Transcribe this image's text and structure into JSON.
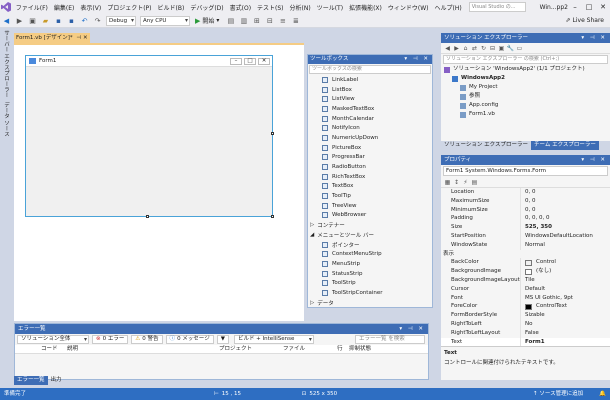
{
  "menu": {
    "items": [
      "ファイル(F)",
      "編集(E)",
      "表示(V)",
      "プロジェクト(P)",
      "ビルド(B)",
      "デバッグ(D)",
      "書式(O)",
      "テスト(S)",
      "分析(N)",
      "ツール(T)",
      "拡張機能(X)",
      "ウィンドウ(W)",
      "ヘルプ(H)"
    ],
    "search_placeholder": "Visual Studio の...",
    "window_title": "Win...pp2"
  },
  "toolbar": {
    "config": "Debug",
    "platform": "Any CPU",
    "start": "開始",
    "live_share": "Live Share"
  },
  "left_tabs": [
    "サーバー エクスプローラー",
    "データ ソース"
  ],
  "doc_tab": "Form1.vb [デザイン]*",
  "form": {
    "title": "Form1"
  },
  "toolbox": {
    "title": "ツールボックス",
    "search_placeholder": "ツールボックスの検索",
    "items": [
      "LinkLabel",
      "ListBox",
      "ListView",
      "MaskedTextBox",
      "MonthCalendar",
      "NotifyIcon",
      "NumericUpDown",
      "PictureBox",
      "ProgressBar",
      "RadioButton",
      "RichTextBox",
      "TextBox",
      "ToolTip",
      "TreeView",
      "WebBrowser"
    ],
    "cat1": "コンテナー",
    "cat2": "メニューとツール バー",
    "items2": [
      "ポインター",
      "ContextMenuStrip",
      "MenuStrip",
      "StatusStrip",
      "ToolStrip",
      "ToolStripContainer"
    ],
    "cat3": "データ"
  },
  "solution": {
    "title": "ソリューション エクスプローラー",
    "search_placeholder": "ソリューション エクスプローラー の検索 (Ctrl+;)",
    "tree": [
      {
        "label": "ソリューション 'WindowsApp2' (1/1 プロジェクト)",
        "indent": 0,
        "bold": false
      },
      {
        "label": "WindowsApp2",
        "indent": 1,
        "bold": true
      },
      {
        "label": "My Project",
        "indent": 2,
        "bold": false
      },
      {
        "label": "参照",
        "indent": 2,
        "bold": false
      },
      {
        "label": "App.config",
        "indent": 2,
        "bold": false
      },
      {
        "label": "Form1.vb",
        "indent": 2,
        "bold": false
      }
    ],
    "tab1": "ソリューション エクスプローラー",
    "tab2": "チーム エクスプローラー"
  },
  "properties": {
    "title": "プロパティ",
    "object": "Form1 System.Windows.Forms.Form",
    "rows": [
      {
        "name": "Location",
        "value": "0, 0"
      },
      {
        "name": "MaximumSize",
        "value": "0, 0"
      },
      {
        "name": "MinimumSize",
        "value": "0, 0"
      },
      {
        "name": "Padding",
        "value": "0, 0, 0, 0"
      },
      {
        "name": "Size",
        "value": "525, 350",
        "bold": true
      },
      {
        "name": "StartPosition",
        "value": "WindowsDefaultLocation"
      },
      {
        "name": "WindowState",
        "value": "Normal"
      },
      {
        "name": "表示",
        "value": "",
        "cat": true
      },
      {
        "name": "BackColor",
        "value": "Control",
        "swatch": "#f0f0f0"
      },
      {
        "name": "BackgroundImage",
        "value": "(なし)",
        "swatch": "#ffffff"
      },
      {
        "name": "BackgroundImageLayout",
        "value": "Tile"
      },
      {
        "name": "Cursor",
        "value": "Default"
      },
      {
        "name": "Font",
        "value": "MS UI Gothic, 9pt"
      },
      {
        "name": "ForeColor",
        "value": "ControlText",
        "swatch": "#000000"
      },
      {
        "name": "FormBorderStyle",
        "value": "Sizable"
      },
      {
        "name": "RightToLeft",
        "value": "No"
      },
      {
        "name": "RightToLeftLayout",
        "value": "False"
      },
      {
        "name": "Text",
        "value": "Form1",
        "bold": true,
        "selected": true
      }
    ],
    "desc_title": "Text",
    "desc_body": "コントロールに関連付けられたテキストです。"
  },
  "errors": {
    "title": "エラー一覧",
    "scope": "ソリューション全体",
    "errors": "0 エラー",
    "warnings": "0 警告",
    "messages": "0 メッセージ",
    "build": "ビルド + IntelliSense",
    "search": "エラー一覧 を検索",
    "cols": [
      "コード",
      "説明",
      "プロジェクト",
      "ファイル",
      "行",
      "抑制状態"
    ],
    "tab1": "エラー一覧",
    "tab2": "出力"
  },
  "status": {
    "ready": "準備完了",
    "pos": "15 , 15",
    "size": "525 x 350",
    "scm": "ソース管理に追加"
  }
}
